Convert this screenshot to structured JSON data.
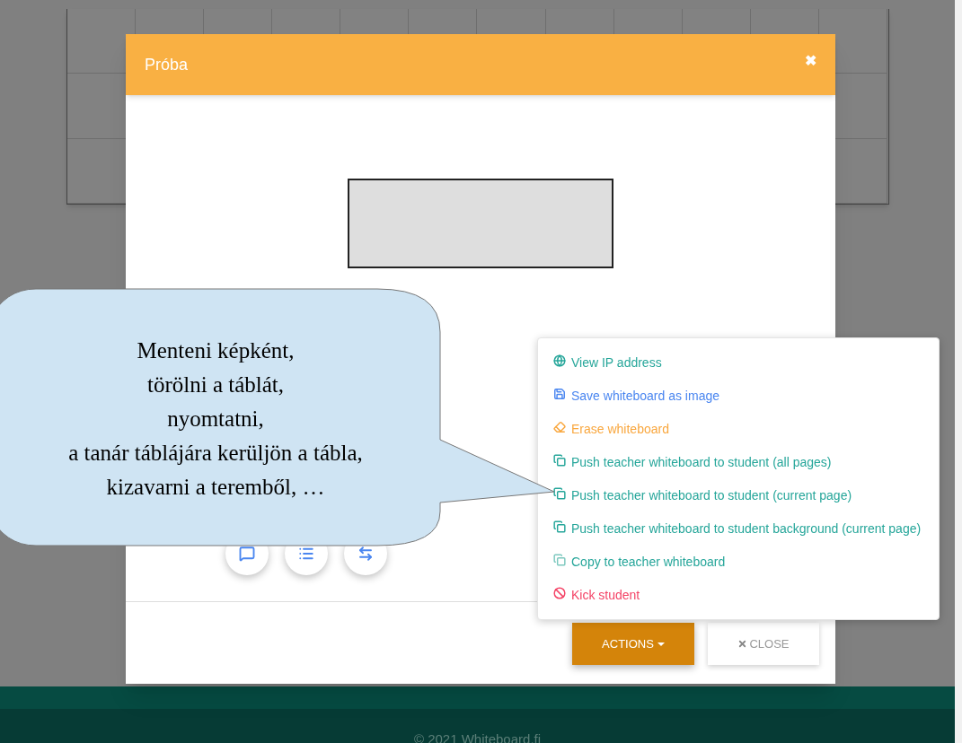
{
  "dialog": {
    "title": "Próba",
    "close_icon": "✖"
  },
  "round_buttons": [
    {
      "kind": "chat"
    },
    {
      "kind": "list"
    },
    {
      "kind": "arrows"
    }
  ],
  "menu": {
    "items": [
      {
        "label": "View IP address",
        "kind": "globe",
        "color": "#26a69a"
      },
      {
        "label": "Save whiteboard as image",
        "kind": "save",
        "color": "#4a86f0"
      },
      {
        "label": "Erase whiteboard",
        "kind": "eraser",
        "color": "#f9a73e"
      },
      {
        "label": "Push teacher whiteboard to student (all pages)",
        "kind": "copy",
        "color": "#26a69a"
      },
      {
        "label": "Push teacher whiteboard to student (current page)",
        "kind": "copy",
        "color": "#26a69a"
      },
      {
        "label": "Push teacher whiteboard to student background (current page)",
        "kind": "copy",
        "color": "#26a69a"
      },
      {
        "label": "Copy to teacher whiteboard",
        "kind": "copy-light",
        "color": "#26a69a"
      },
      {
        "label": "Kick student",
        "kind": "ban",
        "color": "#f44366"
      }
    ]
  },
  "buttons": [
    {
      "label": "ACTIONS",
      "kind": "dropdown"
    },
    {
      "label": "CLOSE",
      "kind": "close"
    }
  ],
  "callout": {
    "lines": [
      "Menteni képként,",
      "törölni a táblát,",
      "nyomtatni,",
      "a tanár táblájára kerüljön a tábla,",
      "kizavarni a teremből, …"
    ]
  },
  "footer": {
    "text": "© 2021 Whiteboard.fi"
  }
}
